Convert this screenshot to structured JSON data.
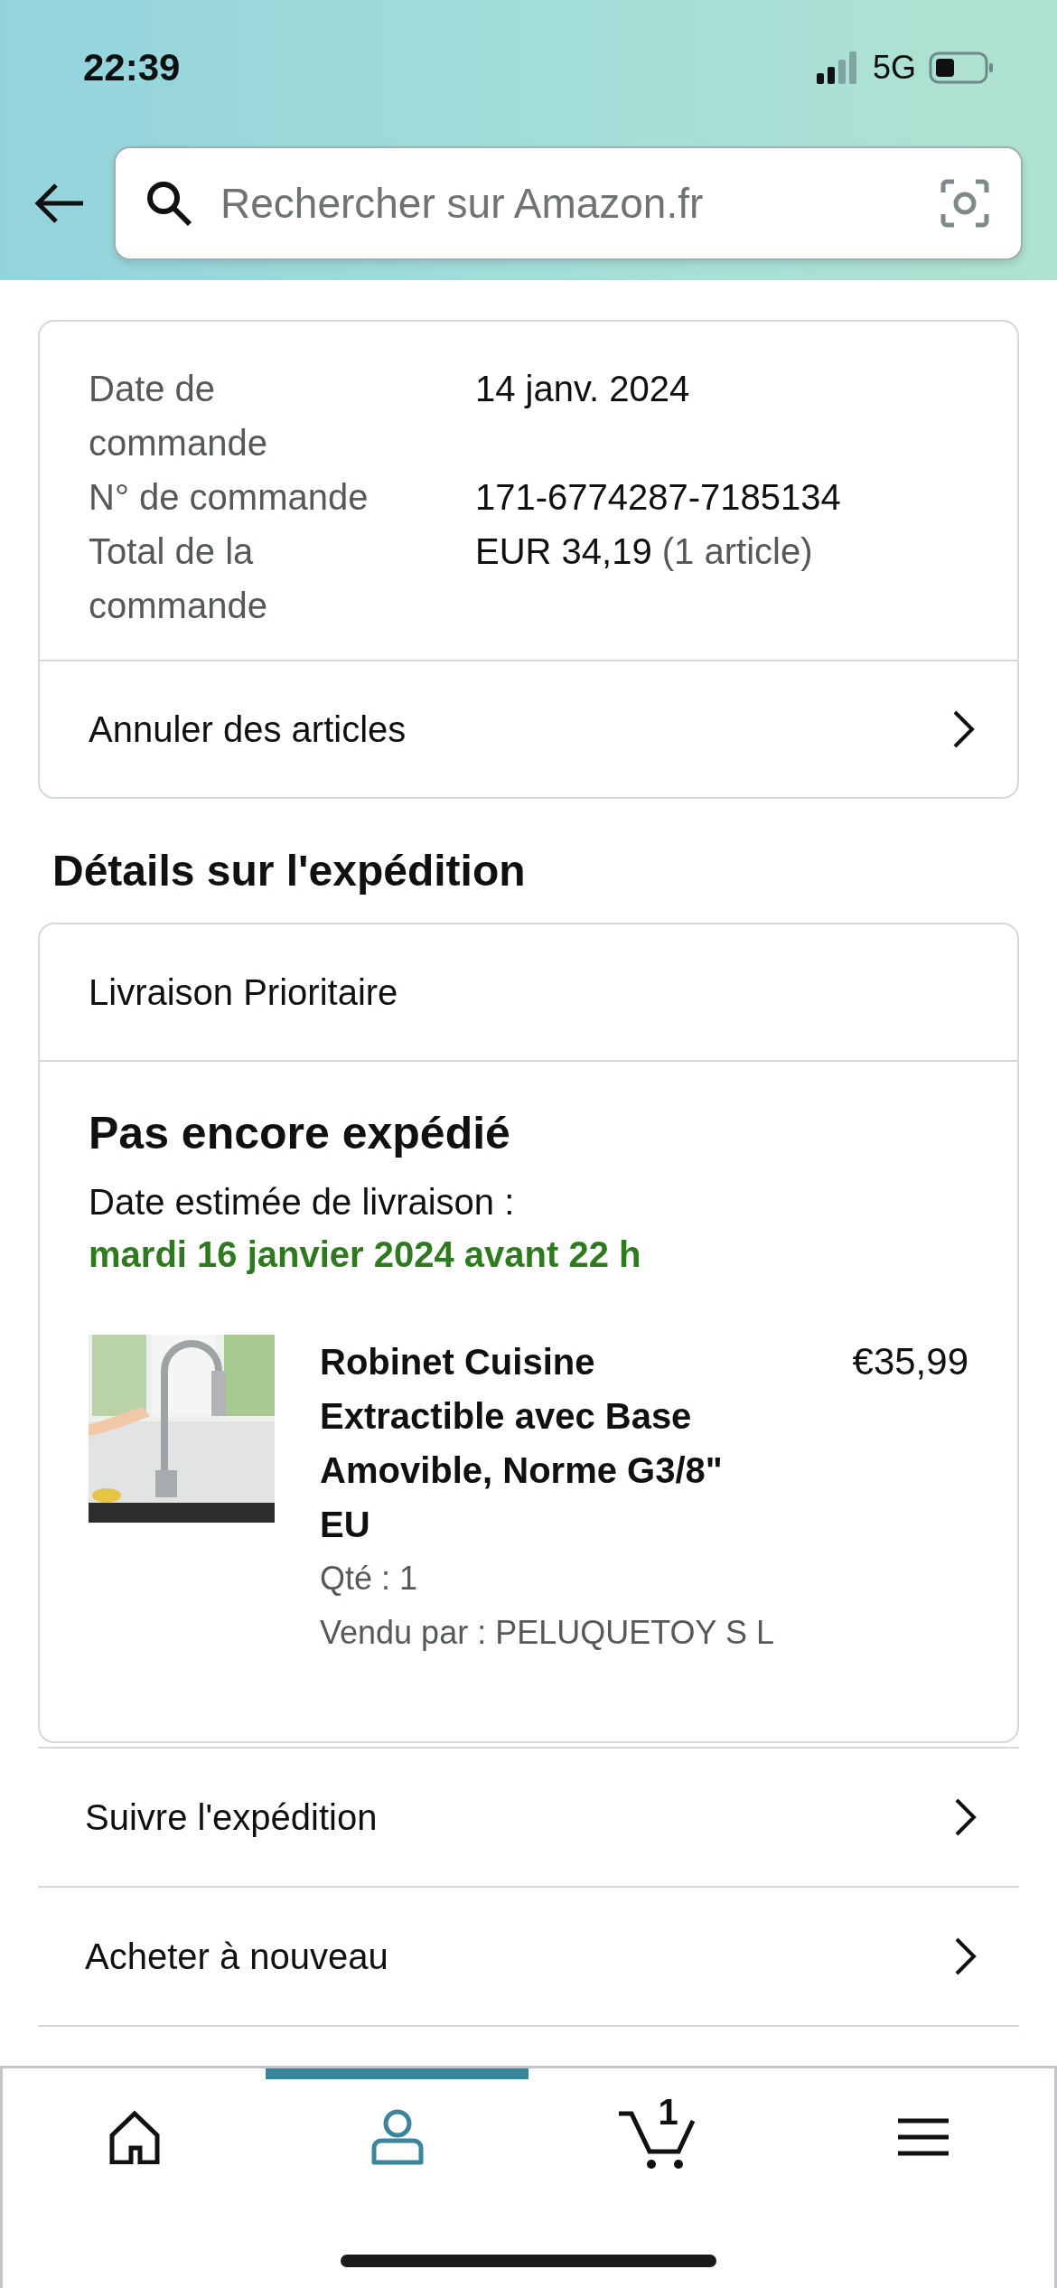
{
  "status_bar": {
    "time": "22:39",
    "network": "5G"
  },
  "search": {
    "placeholder": "Rechercher sur Amazon.fr"
  },
  "order_summary": {
    "fields": [
      {
        "label": "Date de commande",
        "value": "14 janv. 2024"
      },
      {
        "label": "N° de commande",
        "value": "171-6774287-7185134"
      },
      {
        "label": "Total de la commande",
        "value": "EUR 34,19",
        "note": "(1 article)"
      }
    ],
    "action": "Annuler des articles"
  },
  "shipment": {
    "heading": "Détails sur l'expédition",
    "method": "Livraison Prioritaire",
    "status": "Pas encore expédié",
    "delivery_label": "Date estimée de livraison :",
    "delivery_date": "mardi 16 janvier 2024 avant 22 h",
    "item": {
      "kind": "picture",
      "title": "Robinet Cuisine Extractible avec Base Amovible, Norme G3/8\" EU",
      "price": "€35,99",
      "quantity": "Qté : 1",
      "seller": "Vendu par : PELUQUETOY S L"
    }
  },
  "actions": [
    "Suivre l'expédition",
    "Acheter à nouveau"
  ],
  "nav": [
    {
      "kind": "home",
      "selected": false
    },
    {
      "kind": "account",
      "selected": true
    },
    {
      "kind": "cart",
      "badge": "1",
      "selected": false
    },
    {
      "kind": "menu",
      "selected": false
    }
  ]
}
